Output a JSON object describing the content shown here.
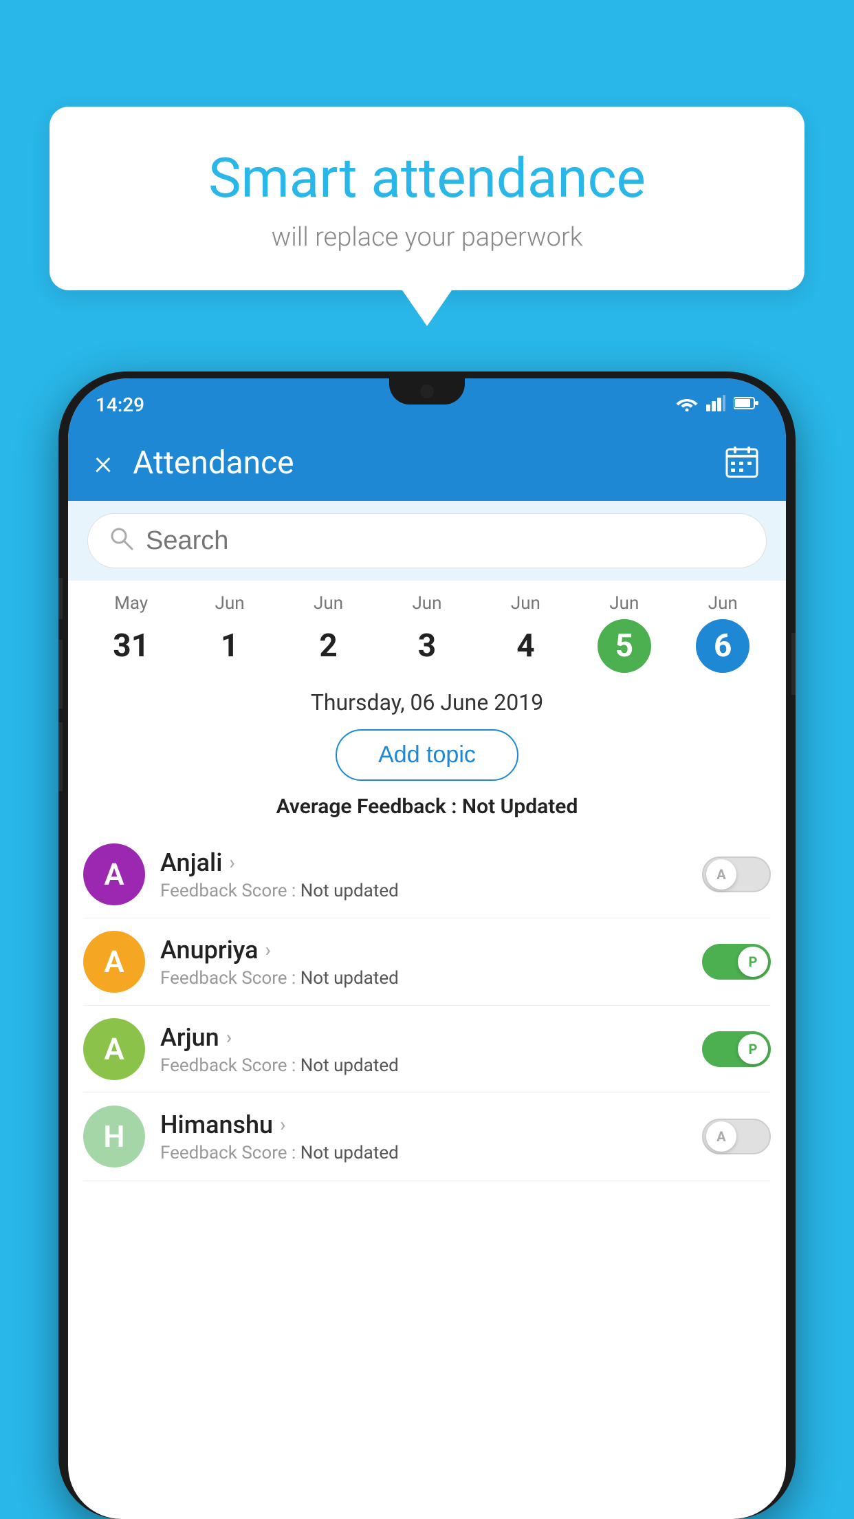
{
  "background_color": "#29b6e8",
  "speech_bubble": {
    "title": "Smart attendance",
    "subtitle": "will replace your paperwork"
  },
  "status_bar": {
    "time": "14:29",
    "wifi": "▾",
    "signal": "▾",
    "battery": "▮"
  },
  "app_bar": {
    "title": "Attendance",
    "close_label": "×",
    "calendar_icon": "calendar"
  },
  "search": {
    "placeholder": "Search"
  },
  "dates": [
    {
      "month": "May",
      "day": "31",
      "selected": ""
    },
    {
      "month": "Jun",
      "day": "1",
      "selected": ""
    },
    {
      "month": "Jun",
      "day": "2",
      "selected": ""
    },
    {
      "month": "Jun",
      "day": "3",
      "selected": ""
    },
    {
      "month": "Jun",
      "day": "4",
      "selected": ""
    },
    {
      "month": "Jun",
      "day": "5",
      "selected": "green"
    },
    {
      "month": "Jun",
      "day": "6",
      "selected": "blue"
    }
  ],
  "selected_date_label": "Thursday, 06 June 2019",
  "add_topic_label": "Add topic",
  "avg_feedback_label": "Average Feedback : ",
  "avg_feedback_value": "Not Updated",
  "students": [
    {
      "name": "Anjali",
      "avatar_letter": "A",
      "avatar_color": "#9c27b0",
      "feedback_label": "Feedback Score : ",
      "feedback_value": "Not updated",
      "toggle_state": "off",
      "toggle_letter": "A"
    },
    {
      "name": "Anupriya",
      "avatar_letter": "A",
      "avatar_color": "#f5a623",
      "feedback_label": "Feedback Score : ",
      "feedback_value": "Not updated",
      "toggle_state": "on",
      "toggle_letter": "P"
    },
    {
      "name": "Arjun",
      "avatar_letter": "A",
      "avatar_color": "#8bc34a",
      "feedback_label": "Feedback Score : ",
      "feedback_value": "Not updated",
      "toggle_state": "on",
      "toggle_letter": "P"
    },
    {
      "name": "Himanshu",
      "avatar_letter": "H",
      "avatar_color": "#a5d6a7",
      "feedback_label": "Feedback Score : ",
      "feedback_value": "Not updated",
      "toggle_state": "off",
      "toggle_letter": "A"
    }
  ]
}
